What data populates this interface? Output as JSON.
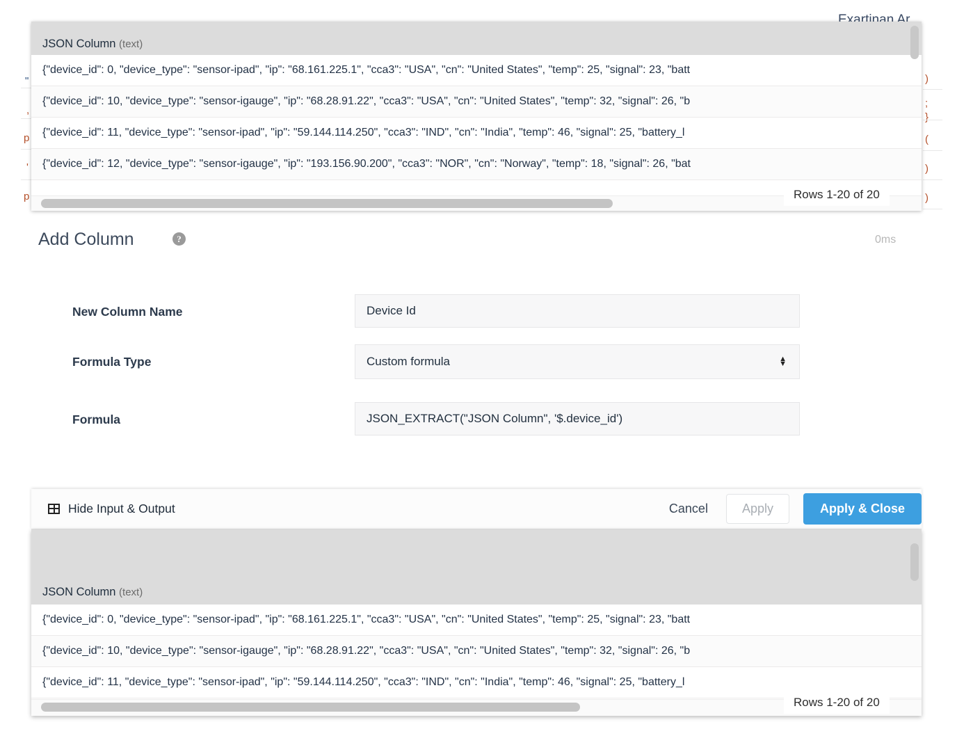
{
  "background": {
    "title_fragment": "Exartinan Ar",
    "left_fragments": [
      "\"",
      ",",
      "p",
      "'",
      "p"
    ],
    "right_fragments": [
      ")",
      ";",
      "}",
      "(",
      ")",
      ")",
      "}",
      "|",
      ")"
    ]
  },
  "input_table_top": {
    "column_header": "JSON Column",
    "column_type": "(text)",
    "rows": [
      "{\"device_id\": 0, \"device_type\": \"sensor-ipad\", \"ip\": \"68.161.225.1\", \"cca3\": \"USA\", \"cn\": \"United States\", \"temp\": 25, \"signal\": 23, \"batt",
      "{\"device_id\": 10, \"device_type\": \"sensor-igauge\", \"ip\": \"68.28.91.22\", \"cca3\": \"USA\", \"cn\": \"United States\", \"temp\": 32, \"signal\": 26, \"b",
      "{\"device_id\": 11, \"device_type\": \"sensor-ipad\", \"ip\": \"59.144.114.250\", \"cca3\": \"IND\", \"cn\": \"India\", \"temp\": 46, \"signal\": 25, \"battery_l",
      "{\"device_id\": 12, \"device_type\": \"sensor-igauge\", \"ip\": \"193.156.90.200\", \"cca3\": \"NOR\", \"cn\": \"Norway\", \"temp\": 18, \"signal\": 26, \"bat"
    ],
    "rows_status": "Rows 1-20 of 20"
  },
  "add_column": {
    "title": "Add Column",
    "help_icon": "help-circle-icon",
    "timing": "0ms",
    "fields": [
      {
        "label": "New Column Name",
        "value": "Device Id",
        "kind": "text"
      },
      {
        "label": "Formula Type",
        "value": "Custom formula",
        "kind": "select"
      },
      {
        "label": "Formula",
        "value": "JSON_EXTRACT(\"JSON Column\", '$.device_id')",
        "kind": "text"
      }
    ]
  },
  "action_bar": {
    "toggle_icon": "table-grid-icon",
    "toggle_label": "Hide Input & Output",
    "cancel_label": "Cancel",
    "apply_label": "Apply",
    "apply_close_label": "Apply & Close",
    "primary_color": "#3d9fe0"
  },
  "output_table_bottom": {
    "column_header": "JSON Column",
    "column_type": "(text)",
    "rows": [
      "{\"device_id\": 0, \"device_type\": \"sensor-ipad\", \"ip\": \"68.161.225.1\", \"cca3\": \"USA\", \"cn\": \"United States\", \"temp\": 25, \"signal\": 23, \"batt",
      "{\"device_id\": 10, \"device_type\": \"sensor-igauge\", \"ip\": \"68.28.91.22\", \"cca3\": \"USA\", \"cn\": \"United States\", \"temp\": 32, \"signal\": 26, \"b",
      "{\"device_id\": 11, \"device_type\": \"sensor-ipad\", \"ip\": \"59.144.114.250\", \"cca3\": \"IND\", \"cn\": \"India\", \"temp\": 46, \"signal\": 25, \"battery_l"
    ],
    "rows_status": "Rows 1-20 of 20"
  }
}
